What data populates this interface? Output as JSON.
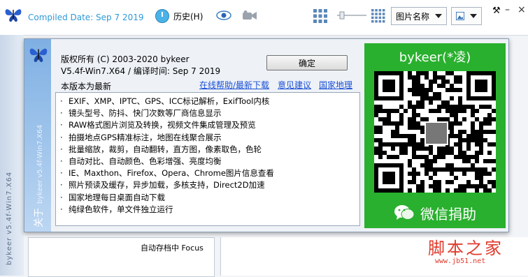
{
  "window": {
    "compiled_date": "Compiled Date: Sep  7 2019",
    "history_label": "历史(H)",
    "sort_select": "图片名称",
    "folder_item": "自动存档中 Focus"
  },
  "dialog": {
    "side_title": "关于",
    "side_version": "bykeer v5.4f-Win7.X64",
    "copyright": "版权所有 (C) 2003-2020   bykeer",
    "version": "V5.4f-Win7.X64 / 编译时间: Sep  7 2019",
    "latest": "本版本为最新",
    "ok_label": "确定",
    "links": {
      "help": "在线帮助/最新下载",
      "feedback": "意见建议",
      "geo": "国家地理"
    },
    "features": [
      "EXIF、XMP、IPTC、GPS、ICC标记解析，ExifTool内核",
      "镜头型号、防抖、快门次数等厂商信息显示",
      "RAW格式图片浏览及转换，视频文件集成管理及预览",
      "拍摄地点GPS精准标注，地图在线聚合展示",
      "批量缩放，裁剪，自动翻转，直方图，像素取色，色轮",
      "自动对比、自动颜色、色彩增强、亮度均衡",
      "IE、Maxthon、Firefox、Opera、Chrome图片信息查看",
      "照片预读及缓存，异步加载，多核支持，Direct2D加速",
      "国家地理每日桌面自动下载",
      "纯绿色软件，单文件独立运行"
    ],
    "feature_bullet": "·",
    "qr_title": "bykeer(*凌)",
    "wechat_label": "微信捐助"
  },
  "watermark": {
    "main": "脚本之家",
    "sub": "www.jb51.net"
  },
  "colors": {
    "accent_blue": "#2f9ad8",
    "link_blue": "#1a4fd6",
    "wechat_green": "#29b02e",
    "watermark_red": "#e03a2c"
  },
  "icons": [
    "butterfly-logo-icon",
    "clock-icon",
    "eye-icon",
    "video-camera-icon",
    "grid-large-icon",
    "grid-small-icon",
    "slider-icon",
    "image-view-icon",
    "wrench-icon",
    "qr-code-icon",
    "wechat-icon"
  ]
}
